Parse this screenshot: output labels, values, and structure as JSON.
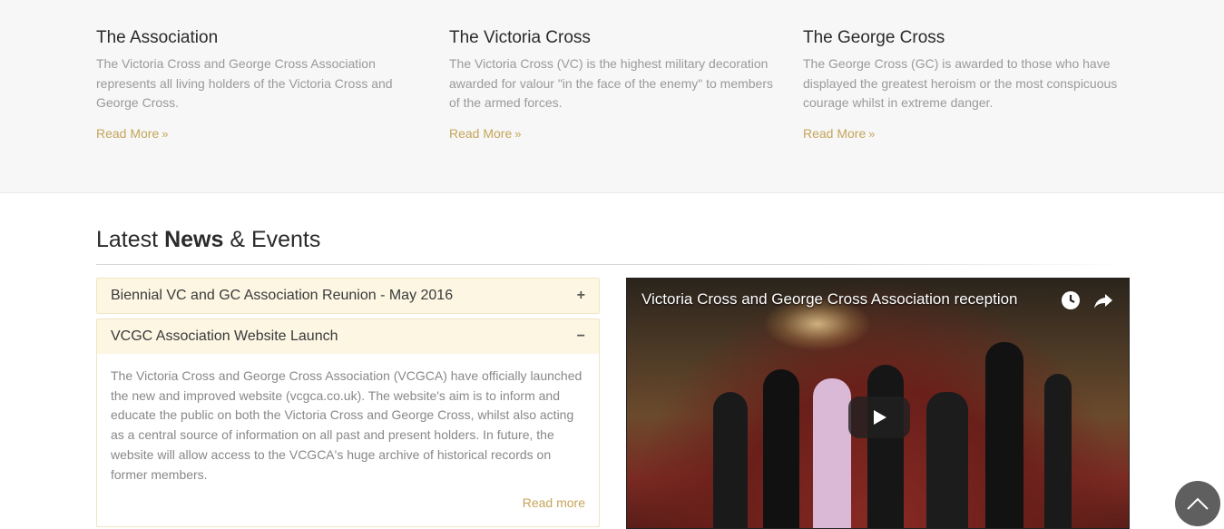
{
  "features": [
    {
      "title": "The Association",
      "text": "The Victoria Cross and George Cross Association represents all living holders of the Victoria Cross and George Cross.",
      "link": "Read More"
    },
    {
      "title": "The Victoria Cross",
      "text": "The Victoria Cross (VC) is the highest military decoration awarded for valour \"in the face of the enemy\" to members of the armed forces.",
      "link": "Read More"
    },
    {
      "title": "The George Cross",
      "text": "The George Cross (GC) is awarded to those who have displayed the greatest heroism or the most conspicuous courage whilst in extreme danger.",
      "link": "Read More"
    }
  ],
  "news": {
    "title_pre": "Latest ",
    "title_bold": "News",
    "title_post": " & Events",
    "items": [
      {
        "label": "Biennial VC and GC Association Reunion - May 2016",
        "sign": "+"
      },
      {
        "label": "VCGC Association Website Launch",
        "sign": "−"
      }
    ],
    "open_body": "The Victoria Cross and George Cross Association (VCGCA) have officially launched the new and improved website (vcgca.co.uk). The website's aim is to inform and educate the public on both the Victoria Cross and George Cross, whilst also acting as a central source of information on all past and present holders. In future, the website will allow access to the VCGCA's huge archive of historical records on former members.",
    "open_read_more": "Read more"
  },
  "video": {
    "title": "Victoria Cross and George Cross Association reception",
    "icons": [
      "watch-later-icon",
      "share-icon",
      "play-icon"
    ]
  },
  "colors": {
    "accent": "#c5a55a",
    "accordion_header": "#fcf6e3",
    "back_to_top": "#5f5f5f"
  }
}
